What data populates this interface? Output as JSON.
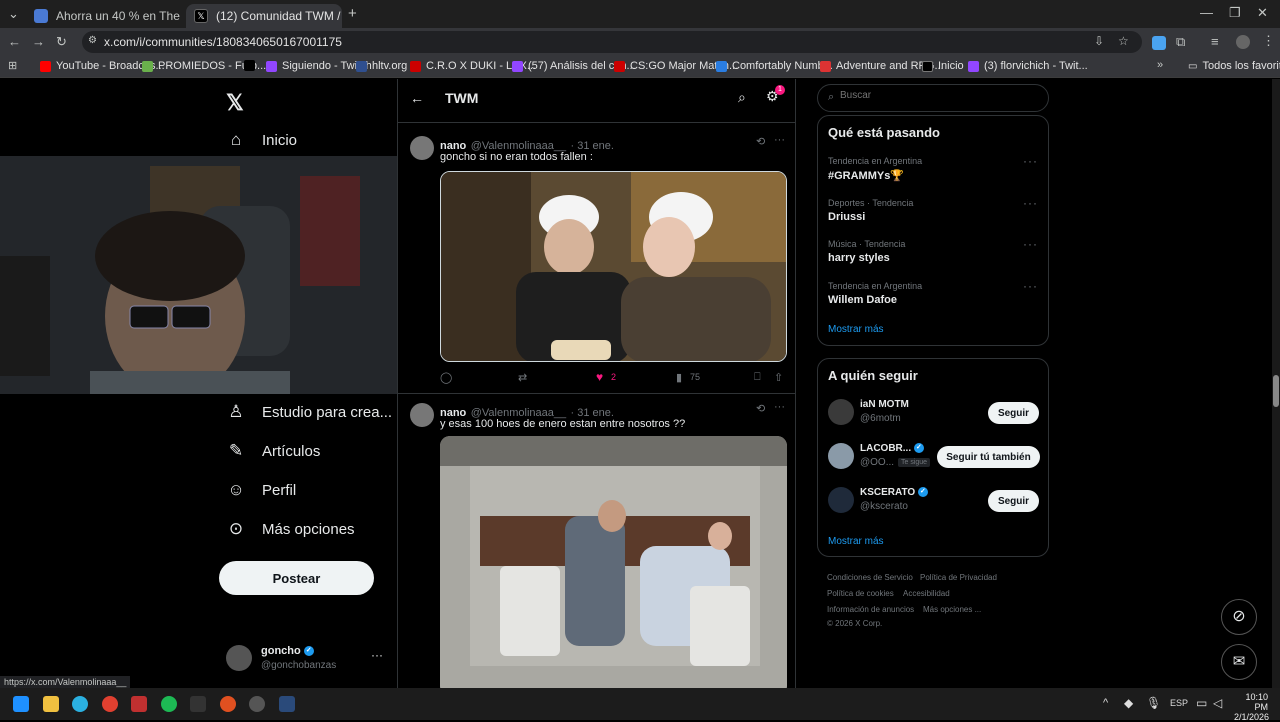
{
  "browser": {
    "tabs": [
      {
        "title": "Ahorra un 40 % en The Headlin"
      },
      {
        "title": "(12) Comunidad TWM / X"
      }
    ],
    "url": "x.com/i/communities/1808340650167001175",
    "bookmarks": [
      "YouTube - Broadcas...",
      "PROMIEDOS - Fútb...",
      "Siguiendo - Twitch",
      "hltv.org",
      "C.R.O X DUKI - LEX...",
      "(57) Análisis del can...",
      "CS:GO Major Match...",
      "Comfortably Numb...",
      "Adventure and RPG...",
      "Inicio",
      "(3) florvichich - Twit..."
    ],
    "all_bookmarks": "Todos los favoritos",
    "status_url": "https://x.com/Valenmolinaaa__"
  },
  "sidebar": {
    "home": "Inicio",
    "studio": "Estudio para crea...",
    "articles": "Artículos",
    "profile": "Perfil",
    "more": "Más opciones",
    "post_button": "Postear",
    "account": {
      "name": "goncho",
      "handle": "@gonchobanzas"
    }
  },
  "community": {
    "title": "TWM",
    "notif_badge": "1"
  },
  "tweets": [
    {
      "name": "nano",
      "handle": "@Valenmolinaaa__",
      "date": "· 31 ene.",
      "text": "goncho si no eran todos fallen :",
      "likes": "2",
      "views": "75"
    },
    {
      "name": "nano",
      "handle": "@Valenmolinaaa__",
      "date": "· 31 ene.",
      "text": "y esas 100 hoes de enero estan entre nosotros ??"
    }
  ],
  "right": {
    "search_placeholder": "Buscar",
    "trends_title": "Qué está pasando",
    "trends": [
      {
        "sub": "Tendencia en Argentina",
        "title": "#GRAMMYs🏆"
      },
      {
        "sub": "Deportes · Tendencia",
        "title": "Driussi"
      },
      {
        "sub": "Música · Tendencia",
        "title": "harry styles"
      },
      {
        "sub": "Tendencia en Argentina",
        "title": "Willem Dafoe"
      }
    ],
    "show_more": "Mostrar más",
    "who_to_follow_title": "A quién seguir",
    "follow": [
      {
        "name": "iaN MOTM",
        "handle": "@6motm",
        "button": "Seguir"
      },
      {
        "name": "LACOBR...",
        "handle": "@OO...",
        "badge": "Te sigue",
        "button": "Seguir tú también"
      },
      {
        "name": "KSCERATO",
        "handle": "@kscerato",
        "button": "Seguir"
      }
    ],
    "footer": [
      "Condiciones de Servicio",
      "Política de Privacidad",
      "Política de cookies",
      "Accesibilidad",
      "Información de anuncios",
      "Más opciones ...",
      "© 2026 X Corp."
    ]
  },
  "taskbar": {
    "lang": "ESP",
    "time": "10:10 PM",
    "date": "2/1/2026"
  }
}
